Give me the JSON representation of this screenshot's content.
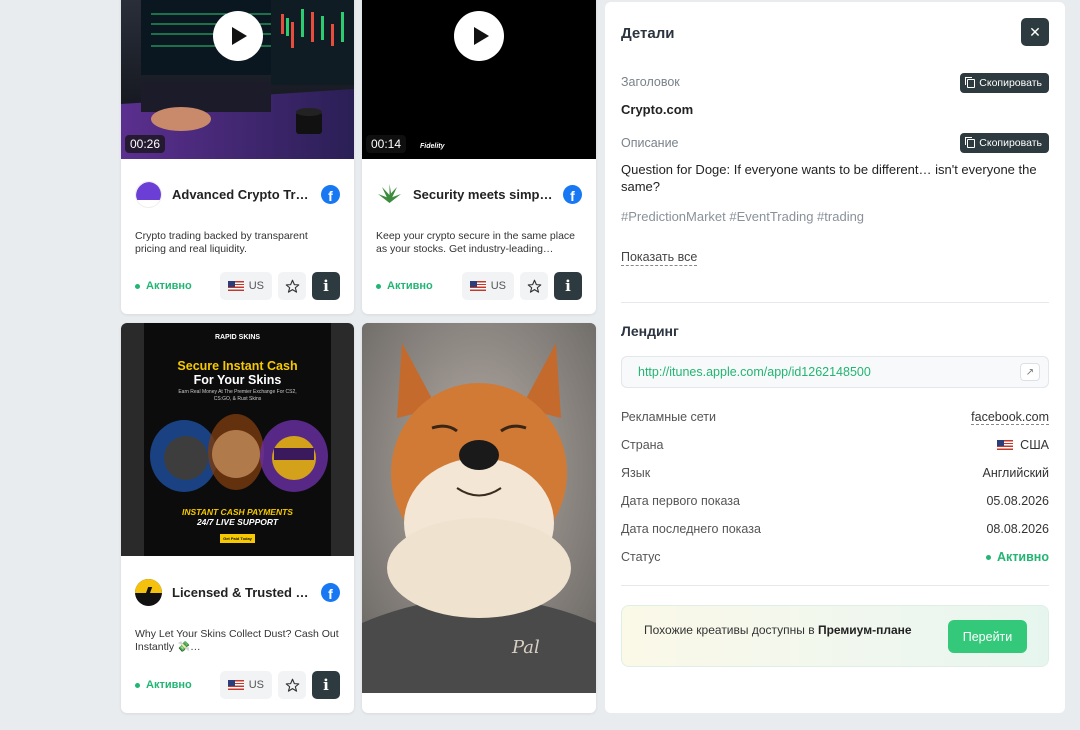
{
  "cards": [
    {
      "duration": "00:26",
      "title": "Advanced Crypto Trading",
      "description": "Crypto trading backed by transparent pricing and real liquidity.",
      "status": "Активно",
      "country": "US"
    },
    {
      "duration": "00:14",
      "brand_tag": "Fidelity",
      "title": "Security meets simplicity",
      "description": "Keep your crypto secure in the same place as your stocks. Get industry-leading…",
      "status": "Активно",
      "country": "US"
    },
    {
      "title": "Licensed & Trusted Gaming",
      "description": "Why Let Your Skins Collect Dust? Cash Out Instantly 💸…",
      "status": "Активно",
      "country": "US",
      "creative": {
        "brand": "RAPID SKINS",
        "headline1": "Secure Instant Cash",
        "headline2": "For Your Skins",
        "sub": "Earn Real Money At The Premier Exchange For CS2, CS:GO, & Rust Skins",
        "banner1": "INSTANT CASH PAYMENTS",
        "banner2": "24/7 LIVE SUPPORT",
        "cta": "Get Paid Today"
      }
    },
    {
      "shirt_text": "Pal"
    }
  ],
  "details": {
    "title": "Детали",
    "close_icon": "✕",
    "headline_label": "Заголовок",
    "copy_label": "Скопировать",
    "headline_value": "Crypto.com",
    "description_label": "Описание",
    "description_value": "Question for Doge: If everyone wants to be different… isn't everyone the same?",
    "tags": "#PredictionMarket #EventTrading #trading",
    "show_all": "Показать все",
    "landing_title": "Лендинг",
    "landing_url": "http://itunes.apple.com/app/id1262148500",
    "rows": [
      {
        "key": "Рекламные сети",
        "value": "facebook.com"
      },
      {
        "key": "Страна",
        "value": "США"
      },
      {
        "key": "Язык",
        "value": "Английский"
      },
      {
        "key": "Дата первого показа",
        "value": "05.08.2026"
      },
      {
        "key": "Дата последнего показа",
        "value": "08.08.2026"
      },
      {
        "key": "Статус",
        "value": "Активно"
      }
    ],
    "premium_text_prefix": "Похожие креативы доступны в ",
    "premium_text_bold": "Премиум-плане",
    "premium_button": "Перейти"
  }
}
